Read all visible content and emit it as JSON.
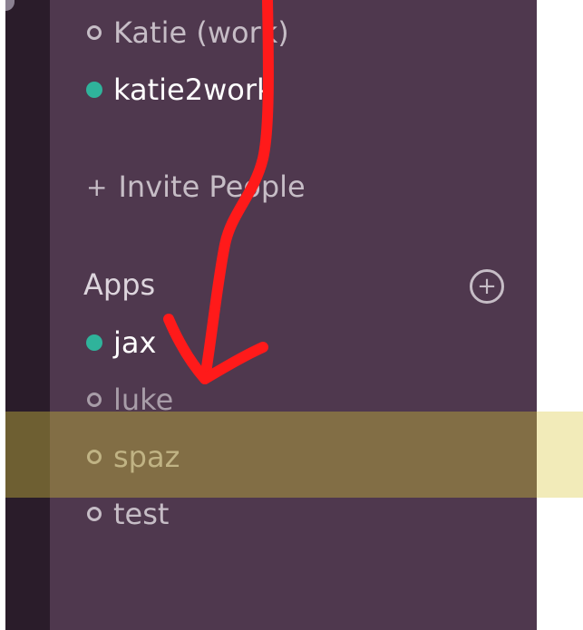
{
  "direct_messages": [
    {
      "label": "Katie (work)",
      "online": false
    },
    {
      "label": "katie2work",
      "online": true
    }
  ],
  "invite": {
    "glyph": "+",
    "label": "Invite People"
  },
  "apps_section": {
    "heading": "Apps",
    "add_glyph": "+",
    "items": [
      {
        "label": "jax",
        "online": true
      },
      {
        "label": "luke",
        "online": false
      },
      {
        "label": "spaz",
        "online": false
      },
      {
        "label": "test",
        "online": false
      }
    ]
  },
  "colors": {
    "sidebar_bg": "#4f384e",
    "team_strip_bg": "#2a1c2a",
    "online_dot": "#2fb39b",
    "highlight": "#b9aa3c",
    "annotation_arrow": "#ff1a1a"
  },
  "icons": {
    "presence_online": "filled-circle-icon",
    "presence_offline": "hollow-circle-icon",
    "invite": "plus-icon",
    "add_app": "circle-plus-icon"
  }
}
